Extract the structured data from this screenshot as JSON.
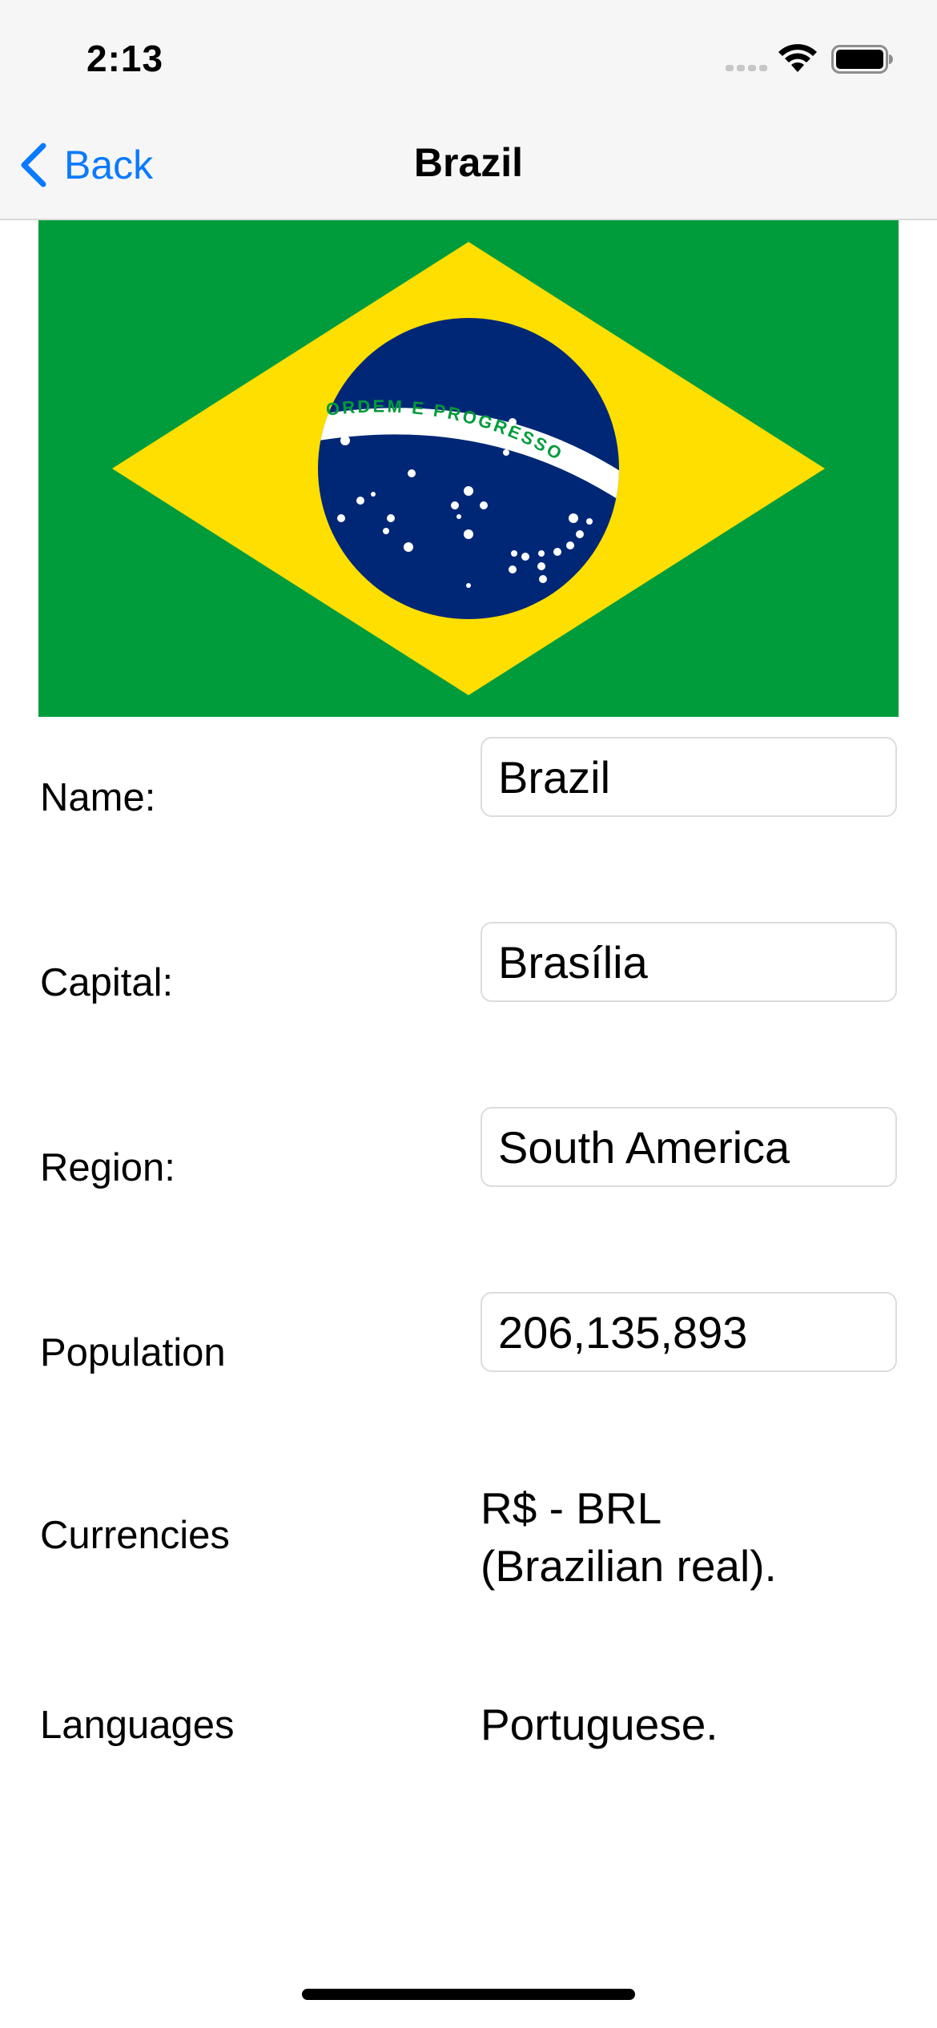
{
  "status_bar": {
    "time": "2:13"
  },
  "nav": {
    "back_label": "Back",
    "title": "Brazil"
  },
  "flag": {
    "motto": "ORDEM E PROGRESSO",
    "colors": {
      "green": "#009c3b",
      "yellow": "#ffdf00",
      "blue": "#002776",
      "white": "#ffffff"
    }
  },
  "details": {
    "name": {
      "label": "Name:",
      "value": "Brazil"
    },
    "capital": {
      "label": "Capital:",
      "value": "Brasília"
    },
    "region": {
      "label": "Region:",
      "value": "South America"
    },
    "population": {
      "label": "Population",
      "value": "206,135,893"
    },
    "currencies": {
      "label": "Currencies",
      "line1": "R$ - BRL",
      "line2": "(Brazilian real)."
    },
    "languages": {
      "label": "Languages",
      "value": "Portuguese."
    }
  },
  "theme": {
    "accent": "#0a7aff",
    "bar_background": "#f6f6f6"
  }
}
